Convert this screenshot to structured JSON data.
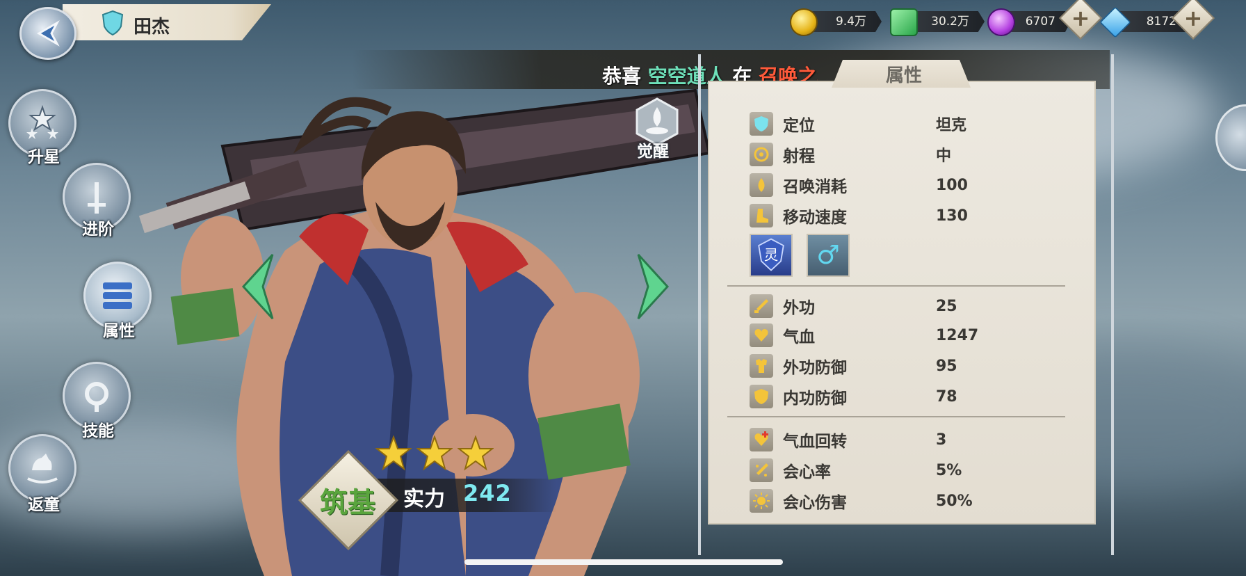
{
  "header": {
    "hero_name": "田杰"
  },
  "resources": {
    "gold": "9.4万",
    "jade": "30.2万",
    "spirit": "6707",
    "diamond": "8172",
    "plus_label": "+"
  },
  "side_menu": {
    "star_up": "升星",
    "advance": "进阶",
    "attributes": "属性",
    "skills": "技能",
    "rejuvenate": "返童"
  },
  "ticker": {
    "prefix": "恭喜",
    "player": "空空道人",
    "mid": "在",
    "place": "召唤之地"
  },
  "awaken_label": "觉醒",
  "hero_card": {
    "stars": 3,
    "rank": "筑基",
    "power_label": "实力",
    "power_value": "242"
  },
  "panel": {
    "tab_label": "属性",
    "info": [
      {
        "label": "定位",
        "value": "坦克",
        "icon": "shield-icon"
      },
      {
        "label": "射程",
        "value": "中",
        "icon": "target-icon"
      },
      {
        "label": "召唤消耗",
        "value": "100",
        "icon": "drop-icon"
      },
      {
        "label": "移动速度",
        "value": "130",
        "icon": "boot-icon"
      }
    ],
    "traits": [
      {
        "name": "spirit-trait-icon",
        "glyph": "灵"
      },
      {
        "name": "male-trait-icon",
        "glyph": "♂"
      }
    ],
    "combat": [
      {
        "label": "外功",
        "value": "25",
        "icon": "sword-icon"
      },
      {
        "label": "气血",
        "value": "1247",
        "icon": "heart-icon"
      },
      {
        "label": "外功防御",
        "value": "95",
        "icon": "armor-icon"
      },
      {
        "label": "内功防御",
        "value": "78",
        "icon": "inner-shield-icon"
      }
    ],
    "advanced": [
      {
        "label": "气血回转",
        "value": "3",
        "icon": "heal-icon"
      },
      {
        "label": "会心率",
        "value": "5%",
        "icon": "crit-rate-icon"
      },
      {
        "label": "会心伤害",
        "value": "50%",
        "icon": "crit-damage-icon"
      }
    ]
  },
  "colors": {
    "accent_green": "#6ee0b9",
    "accent_red": "#ff5a3a",
    "power_cyan": "#7fe9f0",
    "nav_arrow": "#5fd48f"
  }
}
